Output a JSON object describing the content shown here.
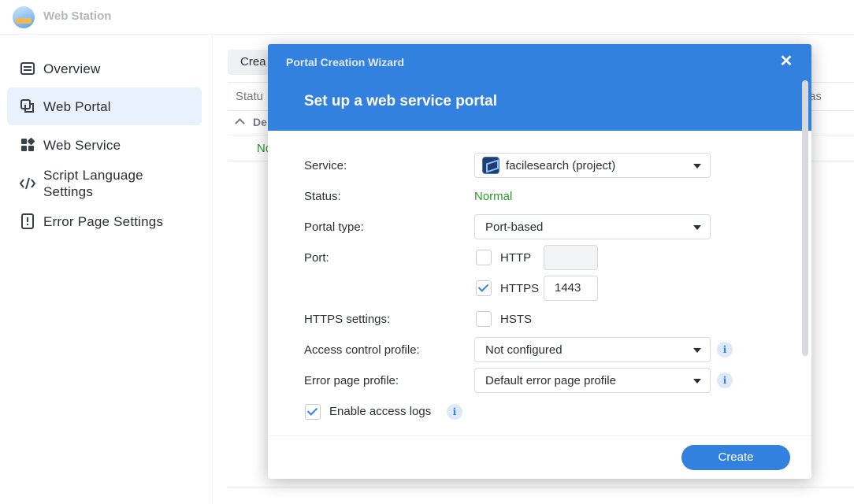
{
  "app": {
    "title": "Web Station"
  },
  "sidebar": {
    "items": [
      {
        "label": "Overview",
        "icon": "list-icon"
      },
      {
        "label": "Web Portal",
        "icon": "portal-icon",
        "active": true
      },
      {
        "label": "Web Service",
        "icon": "grid-icon"
      },
      {
        "label": "Script Language\nSettings",
        "icon": "code-icon"
      },
      {
        "label": "Error Page Settings",
        "icon": "error-icon"
      }
    ]
  },
  "background": {
    "create_button": "Crea",
    "col_status": "Statu",
    "col_alias": "as",
    "group": "De",
    "row_status": "No"
  },
  "dialog": {
    "wizard_title": "Portal Creation Wizard",
    "close": "✕",
    "title": "Set up a web service portal",
    "service_label": "Service:",
    "service_value": "facilesearch (project)",
    "status_label": "Status:",
    "status_value": "Normal",
    "portal_type_label": "Portal type:",
    "portal_type_value": "Port-based",
    "port_label": "Port:",
    "http_label": "HTTP",
    "http_checked": false,
    "http_port": "",
    "https_label": "HTTPS",
    "https_checked": true,
    "https_port": "1443",
    "https_settings_label": "HTTPS settings:",
    "hsts_label": "HSTS",
    "hsts_checked": false,
    "access_label": "Access control profile:",
    "access_value": "Not configured",
    "error_label": "Error page profile:",
    "error_value": "Default error page profile",
    "logs_label": "Enable access logs",
    "logs_checked": true,
    "info_glyph": "i",
    "create_button": "Create"
  },
  "colors": {
    "accent": "#3381df",
    "status_ok": "#2b9a2b"
  }
}
